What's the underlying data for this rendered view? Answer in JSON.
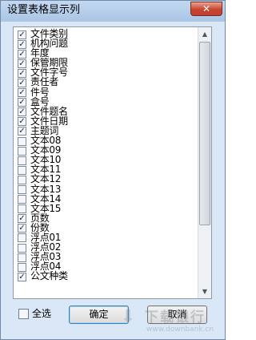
{
  "window": {
    "title": "设置表格显示列",
    "close_label": "✕"
  },
  "columns": [
    {
      "label": "文件类别",
      "checked": true
    },
    {
      "label": "机构问题",
      "checked": true
    },
    {
      "label": "年度",
      "checked": true
    },
    {
      "label": "保管期限",
      "checked": true
    },
    {
      "label": "文件字号",
      "checked": true
    },
    {
      "label": "责任者",
      "checked": true
    },
    {
      "label": "件号",
      "checked": true
    },
    {
      "label": "盒号",
      "checked": true
    },
    {
      "label": "文件题名",
      "checked": true
    },
    {
      "label": "文件日期",
      "checked": true
    },
    {
      "label": "主题词",
      "checked": true
    },
    {
      "label": "文本08",
      "checked": false
    },
    {
      "label": "文本09",
      "checked": false
    },
    {
      "label": "文本10",
      "checked": false
    },
    {
      "label": "文本11",
      "checked": false
    },
    {
      "label": "文本12",
      "checked": false
    },
    {
      "label": "文本13",
      "checked": false
    },
    {
      "label": "文本14",
      "checked": false
    },
    {
      "label": "文本15",
      "checked": false
    },
    {
      "label": "页数",
      "checked": true
    },
    {
      "label": "份数",
      "checked": true
    },
    {
      "label": "浮点01",
      "checked": false
    },
    {
      "label": "浮点02",
      "checked": false
    },
    {
      "label": "浮点03",
      "checked": false
    },
    {
      "label": "浮点04",
      "checked": false
    },
    {
      "label": "公文种类",
      "checked": true
    }
  ],
  "check_glyph": "✓",
  "footer": {
    "select_all_label": "全选",
    "select_all_checked": false,
    "ok_label": "确定",
    "cancel_label": "取消"
  },
  "watermark": {
    "brand": "下载银行",
    "url": "www.downbank.cn"
  }
}
